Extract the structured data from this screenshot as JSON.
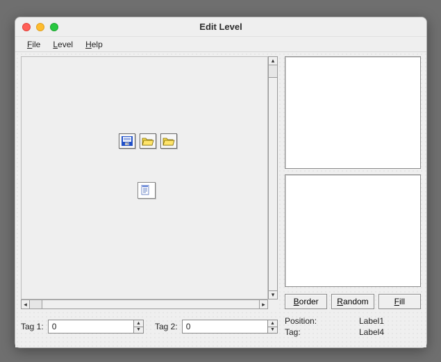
{
  "window": {
    "title": "Edit Level"
  },
  "menubar": {
    "items": [
      {
        "label": "File",
        "mnemonic_index": 0
      },
      {
        "label": "Level",
        "mnemonic_index": 0
      },
      {
        "label": "Help",
        "mnemonic_index": 0
      }
    ]
  },
  "canvas": {
    "icons": [
      "save-icon",
      "open-folder-icon",
      "open-folder-icon"
    ],
    "properties_icon": "properties-icon"
  },
  "side_panels": [
    {
      "name": "palette-a"
    },
    {
      "name": "palette-b"
    }
  ],
  "buttons": {
    "border": {
      "label": "Border",
      "mnemonic_index": 0
    },
    "random": {
      "label": "Random",
      "mnemonic_index": 0
    },
    "fill": {
      "label": "Fill",
      "mnemonic_index": 0
    }
  },
  "tags": {
    "tag1": {
      "label": "Tag 1:",
      "value": "0"
    },
    "tag2": {
      "label": "Tag 2:",
      "value": "0"
    }
  },
  "status": {
    "position_label": "Position:",
    "position_value": "Label1",
    "tag_label": "Tag:",
    "tag_value": "Label4"
  }
}
